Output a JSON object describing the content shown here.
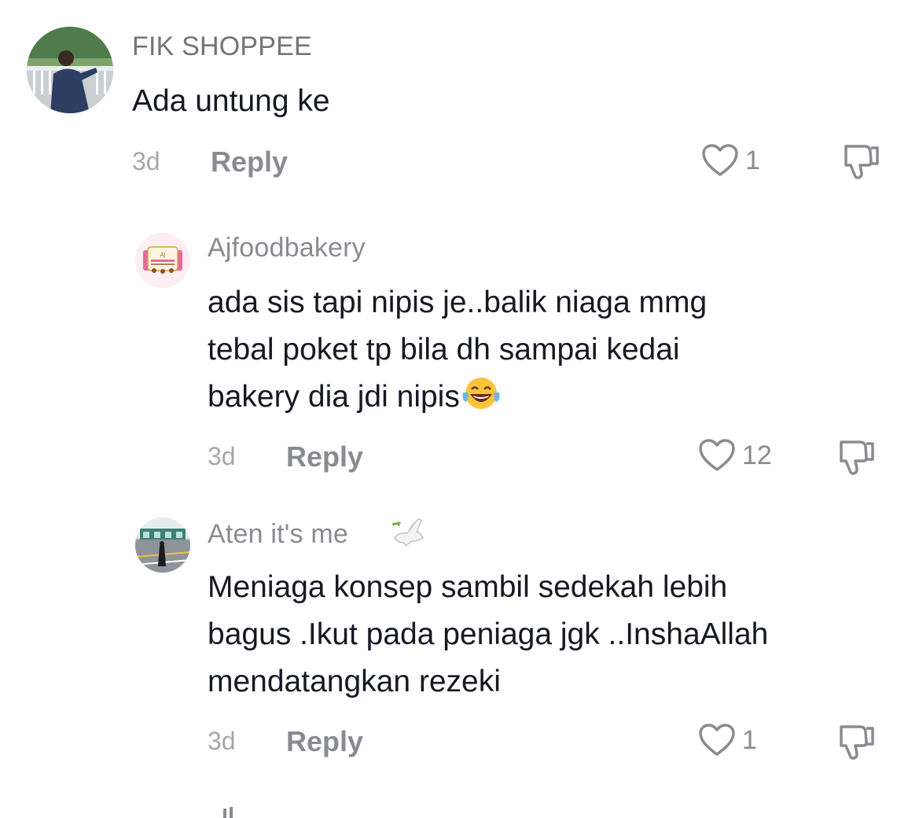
{
  "comments": [
    {
      "username": "FIK SHOPPEE",
      "text_lines": [
        "Ada untung ke"
      ],
      "time": "3d",
      "reply_label": "Reply",
      "likes": "1"
    },
    {
      "username": "Ajfoodbakery",
      "text_lines": [
        "ada sis tapi nipis je..balik niaga mmg",
        "tebal poket tp bila dh sampai kedai",
        "bakery dia jdi nipis"
      ],
      "time": "3d",
      "reply_label": "Reply",
      "likes": "12"
    },
    {
      "username": "Aten it's me",
      "text_lines": [
        "Meniaga konsep sambil sedekah lebih",
        "bagus .Ikut pada peniaga jgk ..InshaAllah",
        "mendatangkan rezeki"
      ],
      "time": "3d",
      "reply_label": "Reply",
      "likes": "1"
    }
  ],
  "icons": {
    "like": "heart-outline-icon",
    "dislike": "thumbs-down-icon",
    "emoji": "laughing-tears-emoji",
    "badge": "dove-emoji"
  },
  "colors": {
    "text": "#161823",
    "muted": "#8a8b91",
    "time": "#a6a7ab"
  }
}
